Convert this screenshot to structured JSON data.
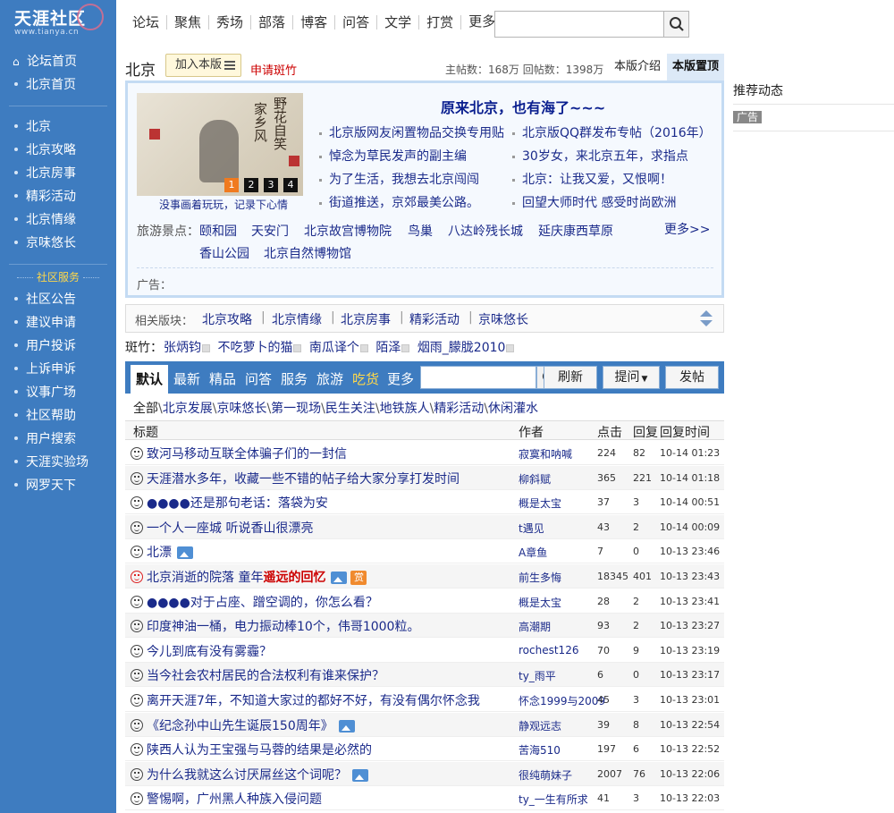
{
  "logo": {
    "title": "天涯社区",
    "subtitle": "www.tianya.cn"
  },
  "sidebar": {
    "top_items": [
      {
        "label": "论坛首页"
      },
      {
        "label": "北京首页"
      }
    ],
    "board_items": [
      {
        "label": "北京"
      },
      {
        "label": "北京攻略"
      },
      {
        "label": "北京房事"
      },
      {
        "label": "精彩活动"
      },
      {
        "label": "北京情缘"
      },
      {
        "label": "京味悠长"
      }
    ],
    "service_title": "社区服务",
    "service_items": [
      {
        "label": "社区公告"
      },
      {
        "label": "建议申请"
      },
      {
        "label": "用户投诉"
      },
      {
        "label": "上诉申诉"
      },
      {
        "label": "议事广场"
      },
      {
        "label": "社区帮助"
      },
      {
        "label": "用户搜索"
      },
      {
        "label": "天涯实验场"
      },
      {
        "label": "网罗天下"
      }
    ]
  },
  "topnav": {
    "items": [
      "论坛",
      "聚焦",
      "秀场",
      "部落",
      "博客",
      "问答",
      "文学",
      "打赏",
      "更多"
    ]
  },
  "board": {
    "name": "北京",
    "join_label": "加入本版",
    "apply_label": "申请斑竹",
    "stats": "主帖数：168万  回帖数：1398万",
    "tab_intro": "本版介绍",
    "tab_top": "本版置顶"
  },
  "feature": {
    "caption": "没事画着玩玩，记录下心情",
    "calligraphy": [
      "野花自笑",
      "家乡风"
    ],
    "dots": [
      "1",
      "2",
      "3",
      "4"
    ],
    "title": "原来北京，也有海了~~~",
    "links_left": [
      "北京版网友闲置物品交换专用贴",
      "悼念为草民发声的副主编",
      "为了生活，我想去北京闯闯",
      "街道推送，京郊最美公路。"
    ],
    "links_right": [
      "北京版QQ群发布专帖（2016年）",
      "30岁女，来北京五年，求指点",
      "北京：让我又爱，又恨啊！",
      "回望大师时代 感受时尚欧洲"
    ],
    "scenic_label": "旅游景点：",
    "scenic_row1": [
      "颐和园",
      "天安门",
      "北京故宫博物院",
      "鸟巢",
      "八达岭残长城",
      "延庆康西草原"
    ],
    "scenic_row2": [
      "香山公园",
      "北京自然博物馆"
    ],
    "more": "更多>>",
    "ad_label": "广告："
  },
  "related": {
    "label": "相关版块：",
    "items": [
      "北京攻略",
      "北京情缘",
      "北京房事",
      "精彩活动",
      "京味悠长"
    ]
  },
  "moderators": {
    "label": "斑竹：",
    "names": [
      "张炳钧",
      "不吃萝卜的猫",
      "南瓜译个",
      "陌泽",
      "烟雨_朦胧2010"
    ]
  },
  "toolbar": {
    "tabs": [
      "默认",
      "最新",
      "精品",
      "问答",
      "服务",
      "旅游",
      "吃货",
      "更多"
    ],
    "refresh": "刷新",
    "ask": "提问",
    "post": "发帖"
  },
  "filter": {
    "items": [
      "全部",
      "北京发展",
      "京味悠长",
      "第一现场",
      "民生关注",
      "地铁族人",
      "精彩活动",
      "休闲灌水"
    ]
  },
  "table": {
    "headers": {
      "title": "标题",
      "author": "作者",
      "clicks": "点击",
      "replies": "回复",
      "time": "回复时间"
    },
    "rows": [
      {
        "title": "致河马移动互联全体骗子们的一封信",
        "author": "寂寞和呐喊",
        "clicks": "224",
        "replies": "82",
        "time": "10-14 01:23"
      },
      {
        "title": "天涯潜水多年，收藏一些不错的帖子给大家分享打发时间",
        "author": "柳斜赋",
        "clicks": "365",
        "replies": "221",
        "time": "10-14 01:18"
      },
      {
        "title": "●●●●还是那句老话：落袋为安",
        "author": "概是太宝",
        "clicks": "37",
        "replies": "3",
        "time": "10-14 00:51"
      },
      {
        "title": "一个人一座城 听说香山很漂亮",
        "author": "t遇见",
        "clicks": "43",
        "replies": "2",
        "time": "10-14 00:09"
      },
      {
        "title": "北漂",
        "author": "A章鱼",
        "clicks": "7",
        "replies": "0",
        "time": "10-13 23:46",
        "pic": true
      },
      {
        "title": "北京消逝的院落 童年",
        "title_hl": "遥远的回忆",
        "author": "前生多悔",
        "clicks": "18345",
        "replies": "401",
        "time": "10-13 23:43",
        "pic": true,
        "reward": "赏",
        "hot": true
      },
      {
        "title": "●●●●对于占座、蹭空调的，你怎么看？",
        "author": "概是太宝",
        "clicks": "28",
        "replies": "2",
        "time": "10-13 23:41"
      },
      {
        "title": "印度神油一桶，电力振动棒10个，伟哥1000粒。",
        "author": "高潮期",
        "clicks": "93",
        "replies": "2",
        "time": "10-13 23:27"
      },
      {
        "title": "今儿到底有没有雾霾？",
        "author": "rochest126",
        "clicks": "70",
        "replies": "9",
        "time": "10-13 23:19"
      },
      {
        "title": "当今社会农村居民的合法权利有谁来保护？",
        "author": "ty_雨平",
        "clicks": "6",
        "replies": "0",
        "time": "10-13 23:17"
      },
      {
        "title": "离开天涯7年，不知道大家过的都好不好，有没有偶尔怀念我",
        "author": "怀念1999与2009",
        "clicks": "45",
        "replies": "3",
        "time": "10-13 23:01"
      },
      {
        "title": "《纪念孙中山先生诞辰150周年》",
        "author": "静观远志",
        "clicks": "39",
        "replies": "8",
        "time": "10-13 22:54",
        "pic": true
      },
      {
        "title": "陕西人认为王宝强与马蓉的结果是必然的",
        "author": "苦海510",
        "clicks": "197",
        "replies": "6",
        "time": "10-13 22:52"
      },
      {
        "title": "为什么我就这么讨厌屌丝这个词呢？",
        "author": "很纯萌妹子",
        "clicks": "2007",
        "replies": "76",
        "time": "10-13 22:06",
        "pic": true
      },
      {
        "title": "警惕啊，广州黑人种族入侵问题",
        "author": "ty_一生有所求",
        "clicks": "41",
        "replies": "3",
        "time": "10-13 22:03"
      }
    ]
  },
  "right": {
    "recommend": "推荐动态",
    "ad": "广告"
  },
  "colors": {
    "sidebar": "#3e7cc0",
    "link": "#1a2a8a",
    "accent_red": "#cc0000",
    "highlight_orange": "#f07a1f"
  }
}
